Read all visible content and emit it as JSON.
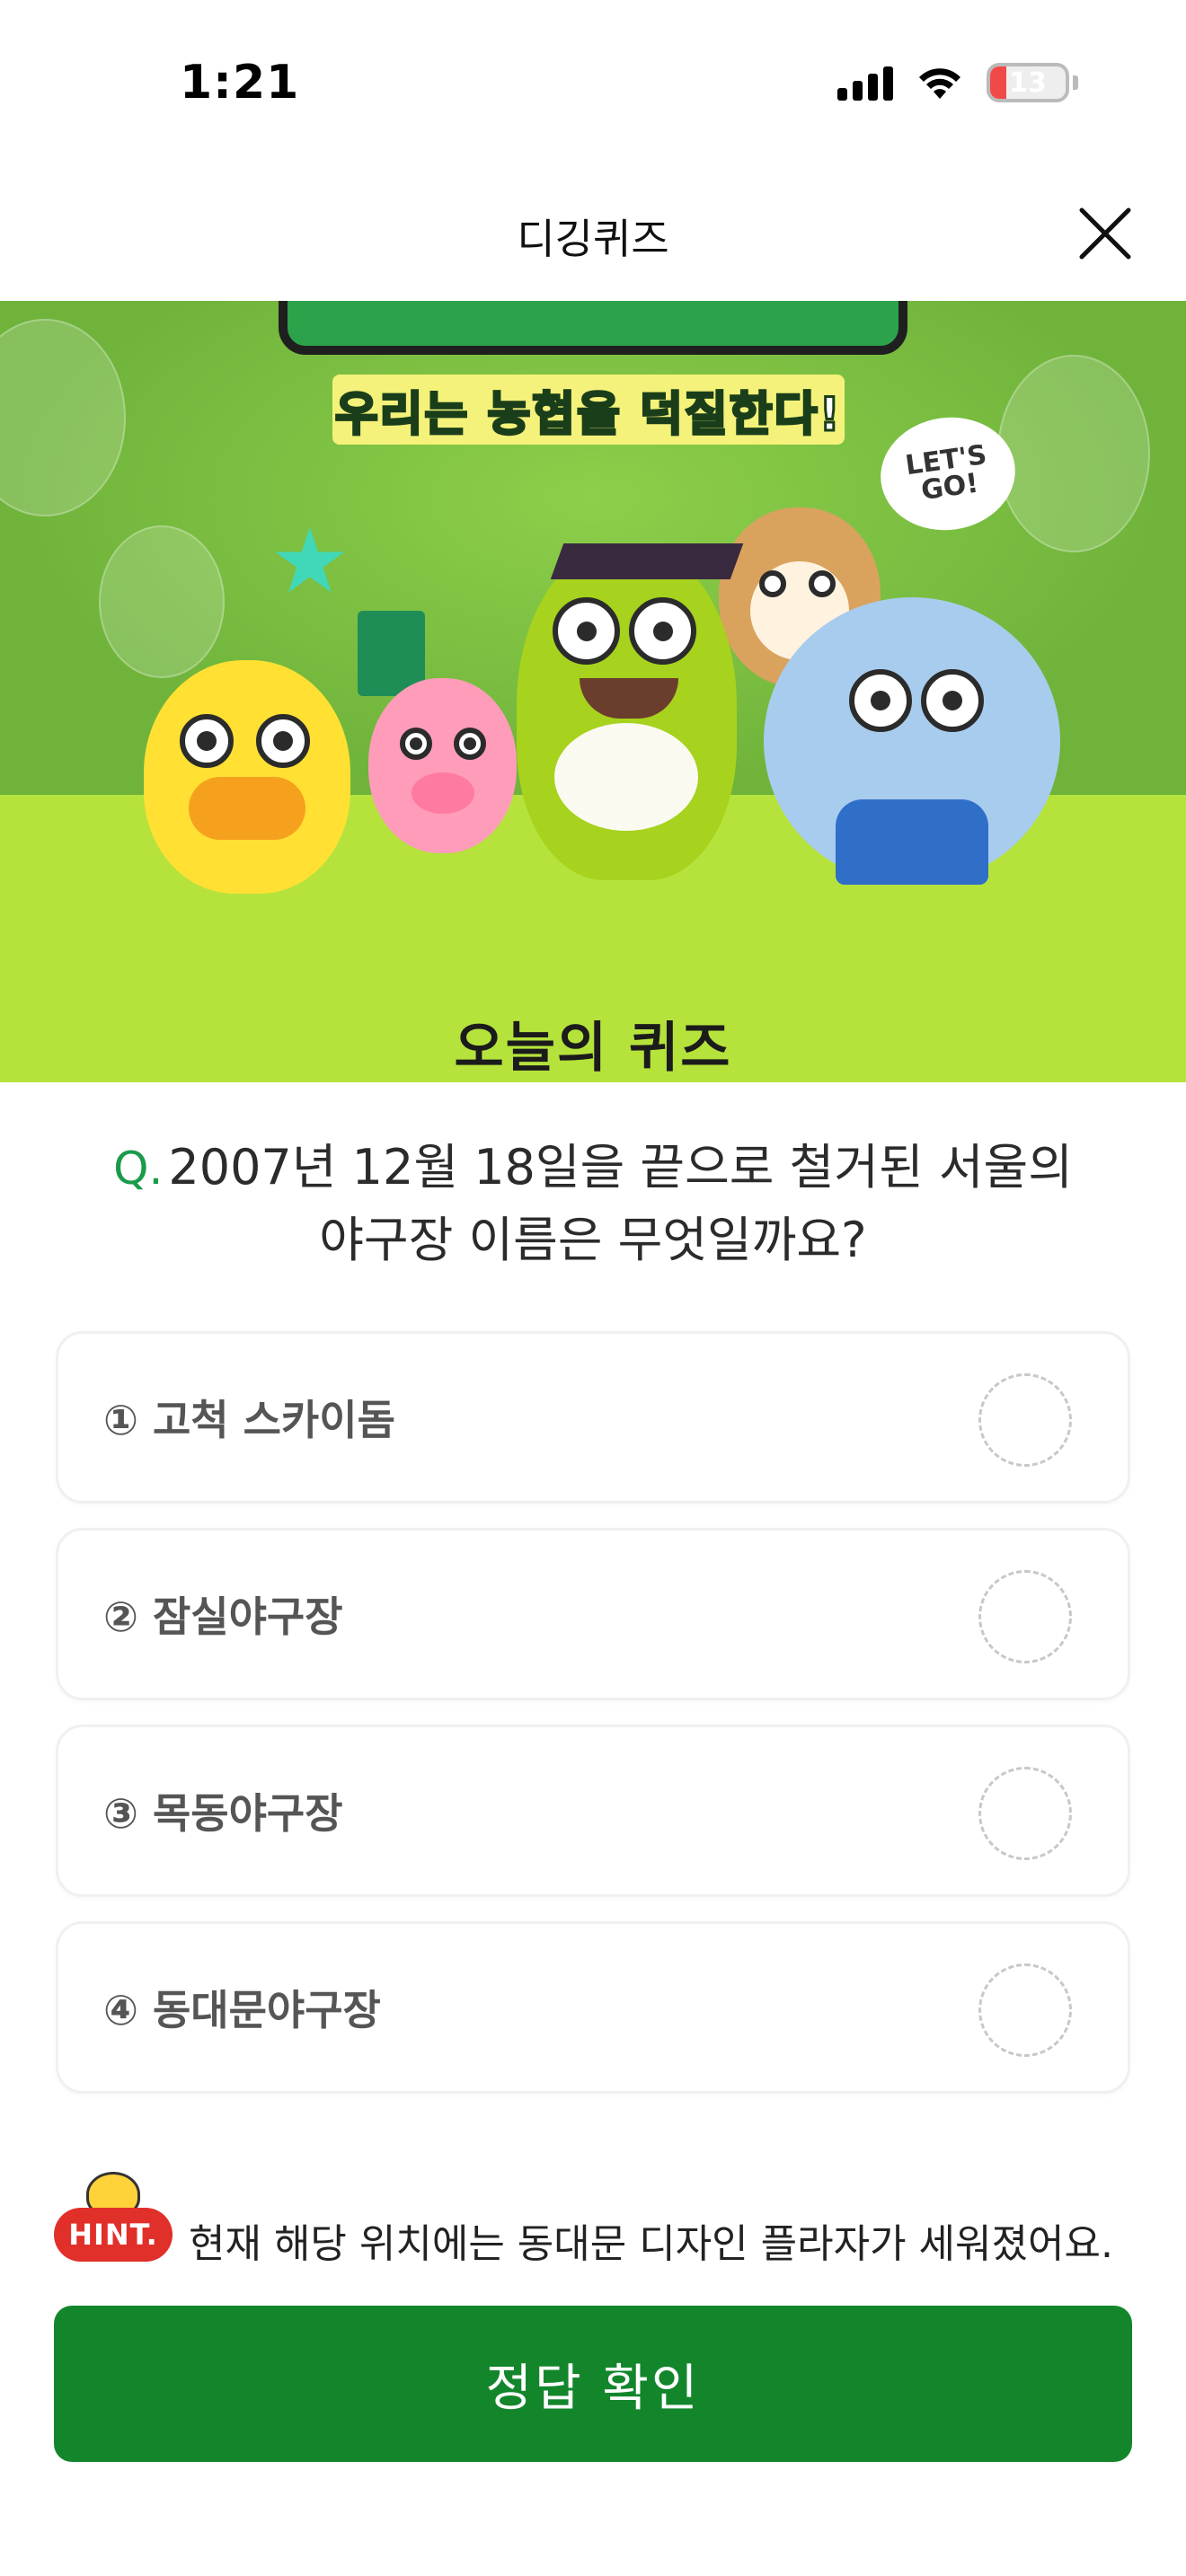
{
  "status_bar": {
    "time": "1:21",
    "battery_level": "13"
  },
  "nav": {
    "title": "디깅퀴즈"
  },
  "banner": {
    "slogan": "우리는 농협을 덕질한다!",
    "bubble_text": "LET'S GO!"
  },
  "quiz": {
    "heading": "오늘의 퀴즈",
    "question_prefix": "Q.",
    "question_text": "2007년 12월 18일을 끝으로 철거된 서울의 야구장 이름은 무엇일까요?",
    "options": [
      {
        "label": "① 고척 스카이돔"
      },
      {
        "label": "② 잠실야구장"
      },
      {
        "label": "③ 목동야구장"
      },
      {
        "label": "④ 동대문야구장"
      }
    ]
  },
  "hint": {
    "badge": "HINT.",
    "text": "현재 해당 위치에는 동대문 디자인 플라자가 세워졌어요."
  },
  "confirm_button": {
    "label": "정답 확인"
  },
  "colors": {
    "accent_green": "#13862c",
    "hint_red": "#e12f2a",
    "question_prefix": "#1a9b4a"
  }
}
